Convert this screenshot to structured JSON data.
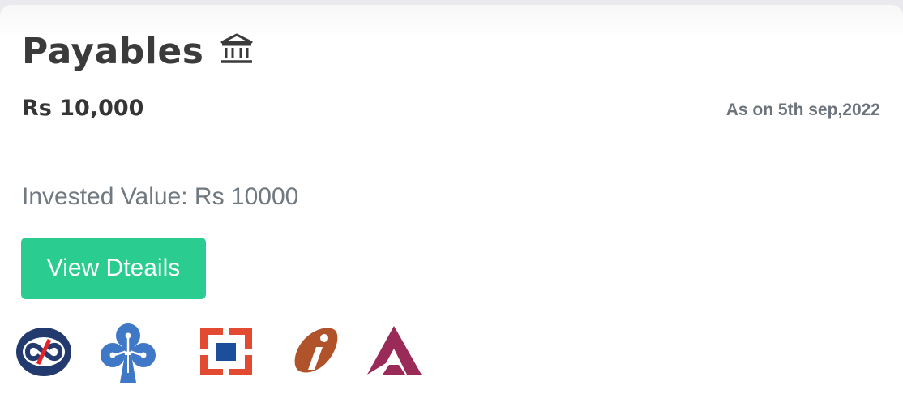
{
  "card": {
    "title": "Payables",
    "title_icon": "bank-icon",
    "amount": "Rs 10,000",
    "as_on": "As on 5th sep,2022",
    "invested_value": "Invested Value: Rs 10000",
    "button_label": "View Dteails"
  },
  "bank_logos": [
    "kotak-logo-icon",
    "sbi-logo-icon",
    "hdfc-logo-icon",
    "icici-logo-icon",
    "axis-logo-icon"
  ],
  "colors": {
    "button": "#2acc8f",
    "title_text": "#3b3b3b",
    "muted_text": "#707880",
    "kotak_blue": "#233a6e",
    "kotak_red": "#e2232a",
    "sbi_blue": "#3e78c6",
    "hdfc_red": "#e24a32",
    "hdfc_blue": "#1d4e9b",
    "icici_orange": "#b1532a",
    "axis_maroon": "#9a2b58"
  }
}
